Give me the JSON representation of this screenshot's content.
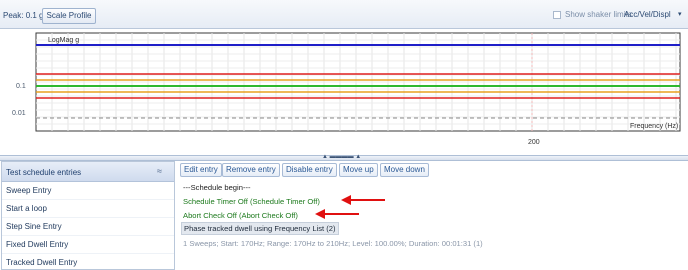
{
  "toolbar": {
    "peak_label": "Peak:",
    "peak_value": "0.1 g",
    "scale_profile_label": "Scale Profile",
    "shaker_limits_label": "Show shaker limits",
    "shaker_limits_checked": false,
    "display_mode": "Acc/Vel/Displ"
  },
  "chart": {
    "legend_label": "LogMag g",
    "y_tick_1": "0.1",
    "y_tick_2": "0.01",
    "x_tick": "200",
    "x_axis_label": "Frequency (Hz)"
  },
  "chart_data": {
    "type": "line",
    "yscale": "log",
    "ytick_labels": [
      "0.1",
      "0.01"
    ],
    "xtick_labels": [
      "200"
    ],
    "xlabel": "Frequency (Hz)",
    "series": [
      {
        "name": "LogMag g",
        "color": "#1e1ec8"
      },
      {
        "color": "#e02020"
      },
      {
        "color": "#e8a020"
      },
      {
        "color": "#2fb82f"
      },
      {
        "color": "#e8a020"
      },
      {
        "color": "#e02020"
      },
      {
        "color": "#8a8a8a"
      }
    ],
    "grid": true
  },
  "left_panel": {
    "title": "Test schedule entries",
    "items": [
      {
        "label": "Sweep Entry"
      },
      {
        "label": "Start a loop"
      },
      {
        "label": "Step Sine Entry"
      },
      {
        "label": "Fixed Dwell Entry"
      },
      {
        "label": "Tracked Dwell Entry"
      }
    ]
  },
  "right_panel": {
    "buttons": {
      "edit": "Edit entry",
      "remove": "Remove entry",
      "disable": "Disable entry",
      "move_up": "Move up",
      "move_down": "Move down"
    },
    "schedule_lines": {
      "begin": "---Schedule begin---",
      "timer": "Schedule Timer Off (Schedule Timer Off)",
      "abort": "Abort Check Off (Abort Check Off)",
      "phase": "Phase tracked dwell using Frequency List (2)",
      "sweep": "1 Sweeps; Start: 170Hz; Range: 170Hz to 210Hz; Level: 100.00%; Duration: 00:01:31 (1)"
    }
  },
  "colors": {
    "annotation_arrow": "#e01010",
    "highlight_text": "#1d7a1d"
  }
}
